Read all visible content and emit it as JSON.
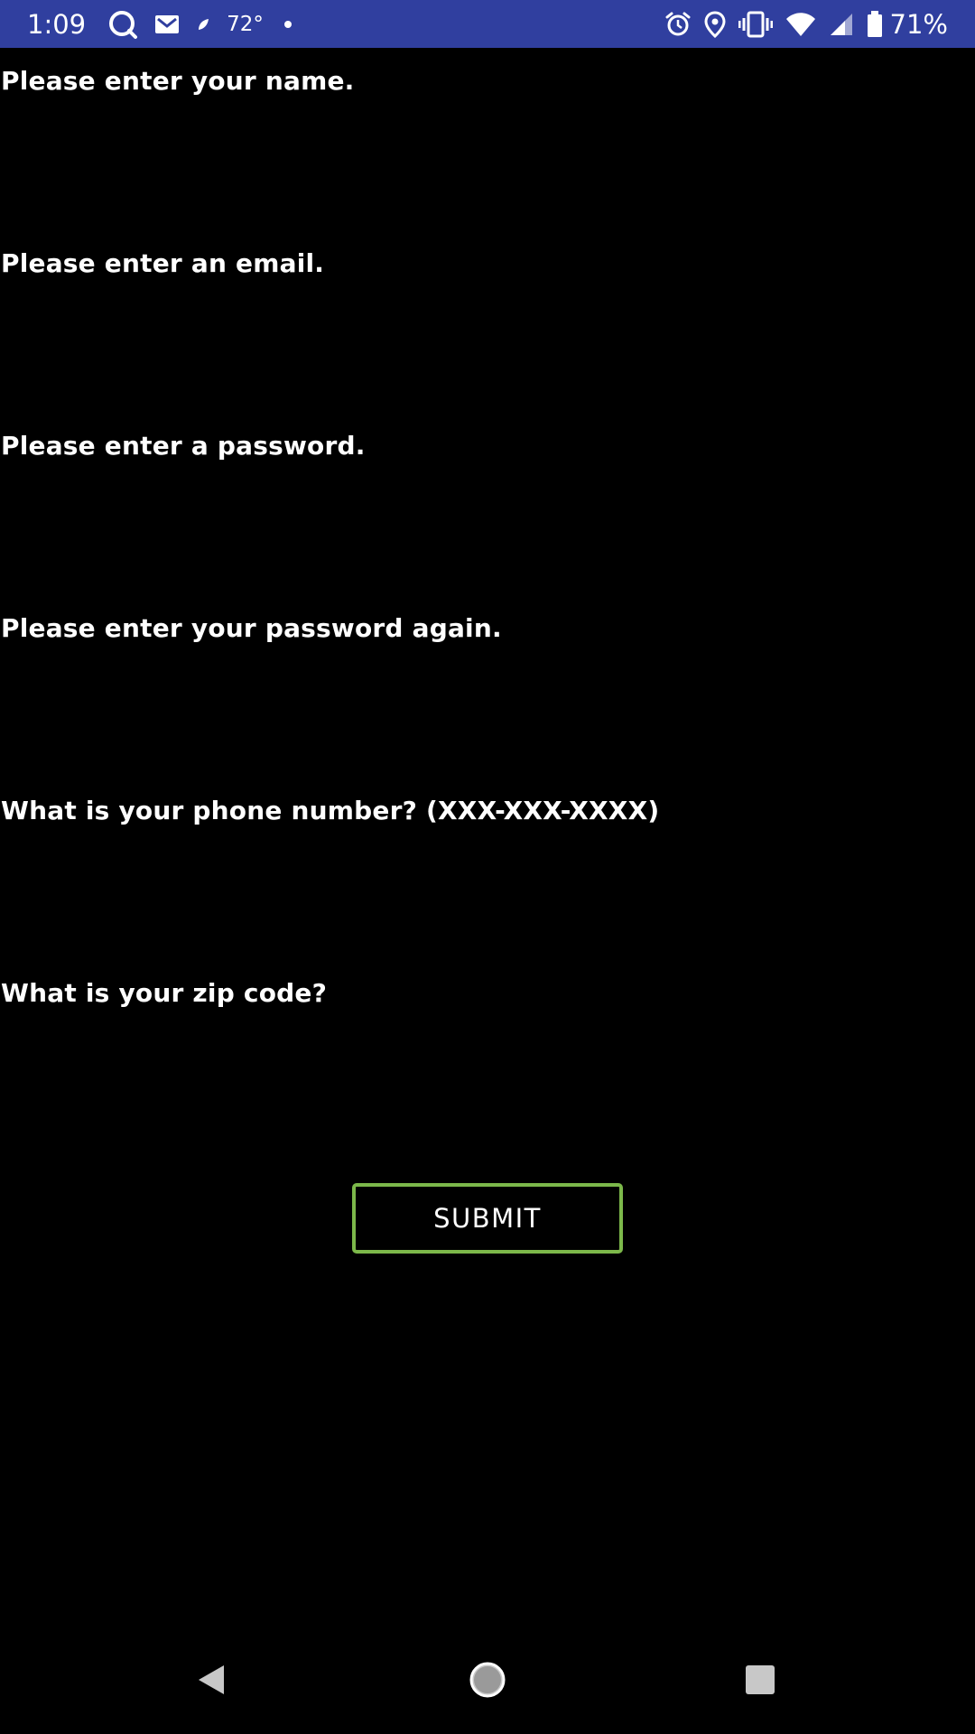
{
  "status_bar": {
    "time": "1:09",
    "temperature": "72°",
    "battery_percent": "71%",
    "left_icons": [
      "q-app-icon",
      "gmail-icon",
      "weather-leaf-icon",
      "notification-dot-icon"
    ],
    "right_icons": [
      "alarm-icon",
      "location-icon",
      "vibrate-icon",
      "wifi-icon",
      "cell-signal-icon",
      "battery-icon"
    ],
    "background_color": "#303f9f"
  },
  "form": {
    "fields": [
      {
        "label": "Please enter your name.",
        "value": "",
        "placeholder": ""
      },
      {
        "label": "Please enter an email.",
        "value": "",
        "placeholder": ""
      },
      {
        "label": "Please enter a password.",
        "value": "",
        "placeholder": ""
      },
      {
        "label": "Please enter your password again.",
        "value": "",
        "placeholder": ""
      },
      {
        "label": "What is your phone number? (XXX-XXX-XXXX)",
        "value": "",
        "placeholder": ""
      },
      {
        "label": "What is your zip code?",
        "value": "",
        "placeholder": ""
      }
    ],
    "submit_label": "SUBMIT",
    "submit_border_color": "#7cb84a"
  },
  "nav_bar": {
    "buttons": [
      "back-icon",
      "home-icon",
      "recents-icon"
    ]
  }
}
